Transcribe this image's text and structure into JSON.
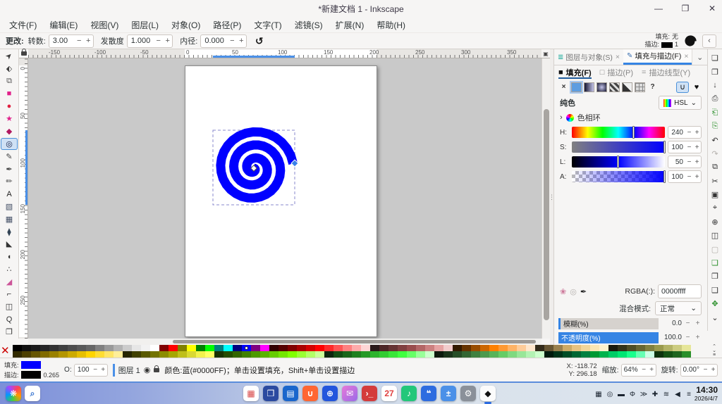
{
  "ui": {
    "minus": "−",
    "plus": "+",
    "caret": "⌄"
  },
  "window": {
    "title": "*新建文档 1 - Inkscape",
    "minimize": "—",
    "maximize": "❐",
    "close": "✕"
  },
  "menu": {
    "items": [
      "文件(F)",
      "编辑(E)",
      "视图(V)",
      "图层(L)",
      "对象(O)",
      "路径(P)",
      "文字(T)",
      "滤镜(S)",
      "扩展(N)",
      "帮助(H)"
    ]
  },
  "tool_options": {
    "prefix": "更改:",
    "fields": [
      {
        "label": "转数:",
        "value": "3.00"
      },
      {
        "label": "发散度",
        "value": "1.000"
      },
      {
        "label": "内径:",
        "value": "0.000"
      }
    ],
    "reset_icon": "↺",
    "style": {
      "fill_label": "填充:",
      "fill_value": "无",
      "stroke_label": "描边:",
      "stroke_value": "1"
    },
    "collapse": "‹"
  },
  "rulers": {
    "h": [
      "-150",
      "-100",
      "-50",
      "0",
      "50",
      "100",
      "150",
      "200",
      "250",
      "300",
      "350"
    ],
    "v": [
      "0",
      "50",
      "100",
      "150",
      "200",
      "250"
    ]
  },
  "toolbox": {
    "items": [
      {
        "name": "selector-tool",
        "glyph": "➤",
        "color": "#3d3d3d",
        "cls": "rot315"
      },
      {
        "name": "node-tool",
        "glyph": "⬖",
        "color": "#3d3d3d",
        "cls": ""
      },
      {
        "name": "shape-builder-tool",
        "glyph": "⧉",
        "color": "#555555",
        "cls": ""
      },
      {
        "name": "rectangle-tool",
        "glyph": "■",
        "color": "#e0218a",
        "cls": ""
      },
      {
        "name": "ellipse-tool",
        "glyph": "●",
        "color": "#e02040",
        "cls": ""
      },
      {
        "name": "star-tool",
        "glyph": "★",
        "color": "#e0218a",
        "cls": ""
      },
      {
        "name": "box3d-tool",
        "glyph": "◆",
        "color": "#b01860",
        "cls": ""
      },
      {
        "name": "spiral-tool",
        "glyph": "◎",
        "color": "#101840",
        "cls": "active"
      },
      {
        "name": "pencil-tool",
        "glyph": "✎",
        "color": "#444444",
        "cls": ""
      },
      {
        "name": "bezier-tool",
        "glyph": "✒",
        "color": "#444444",
        "cls": ""
      },
      {
        "name": "calligraphy-tool",
        "glyph": "✏",
        "color": "#444444",
        "cls": ""
      },
      {
        "name": "text-tool",
        "glyph": "A",
        "color": "#222222",
        "cls": ""
      },
      {
        "name": "gradient-tool",
        "glyph": "▧",
        "color": "#445066",
        "cls": ""
      },
      {
        "name": "mesh-tool",
        "glyph": "▦",
        "color": "#445066",
        "cls": ""
      },
      {
        "name": "dropper-tool",
        "glyph": "⧫",
        "color": "#334455",
        "cls": ""
      },
      {
        "name": "paint-bucket-tool",
        "glyph": "◣",
        "color": "#333333",
        "cls": ""
      },
      {
        "name": "tweak-tool",
        "glyph": "◖",
        "color": "#333333",
        "cls": ""
      },
      {
        "name": "spray-tool",
        "glyph": "∴",
        "color": "#333333",
        "cls": ""
      },
      {
        "name": "eraser-tool",
        "glyph": "◢",
        "color": "#cc5599",
        "cls": ""
      },
      {
        "name": "connector-tool",
        "glyph": "⌐",
        "color": "#333333",
        "cls": ""
      },
      {
        "name": "measure-tool",
        "glyph": "◫",
        "color": "#333333",
        "cls": ""
      },
      {
        "name": "zoom-tool",
        "glyph": "Q",
        "color": "#333333",
        "cls": ""
      },
      {
        "name": "pages-tool",
        "glyph": "❐",
        "color": "#333333",
        "cls": ""
      }
    ]
  },
  "canvas": {
    "spiral_color": "#0000ff",
    "handle_color": "#3a80e8"
  },
  "commands": {
    "items": [
      {
        "name": "new-document-button",
        "glyph": "❏",
        "cls": ""
      },
      {
        "name": "open-button",
        "glyph": "❐",
        "cls": ""
      },
      {
        "name": "save-button",
        "glyph": "↓",
        "cls": ""
      },
      {
        "name": "print-button",
        "glyph": "⎙",
        "cls": ""
      },
      {
        "name": "import-button",
        "glyph": "⎗",
        "cls": "grn"
      },
      {
        "name": "export-button",
        "glyph": "⎘",
        "cls": "grn"
      },
      {
        "name": "undo-button",
        "glyph": "↶",
        "cls": ""
      },
      {
        "name": "redo-button",
        "glyph": "↷",
        "cls": "dim"
      },
      {
        "name": "copy-button",
        "glyph": "⧉",
        "cls": ""
      },
      {
        "name": "cut-button",
        "glyph": "✂",
        "cls": ""
      },
      {
        "name": "paste-button",
        "glyph": "▣",
        "cls": ""
      },
      {
        "name": "zoom-selection-button",
        "glyph": "⌖",
        "cls": ""
      },
      {
        "name": "zoom-drawing-button",
        "glyph": "⊕",
        "cls": ""
      },
      {
        "name": "zoom-page-button",
        "glyph": "◫",
        "cls": ""
      },
      {
        "name": "page-border-button",
        "glyph": "▢",
        "cls": "dim"
      },
      {
        "name": "duplicate-button",
        "glyph": "❏",
        "cls": "grn"
      },
      {
        "name": "clone-button",
        "glyph": "❐",
        "cls": ""
      },
      {
        "name": "unlink-clone-button",
        "glyph": "❑",
        "cls": ""
      },
      {
        "name": "transform-button",
        "glyph": "✥",
        "cls": "grn"
      },
      {
        "name": "more-commands-button",
        "glyph": "⌄",
        "cls": ""
      }
    ]
  },
  "dock": {
    "tabs": [
      {
        "name": "tab-layers-objects",
        "icon": "≣",
        "label": "图层与对象(S)",
        "close": "×",
        "cls": ""
      },
      {
        "name": "tab-fill-stroke",
        "icon": "✎",
        "label": "填充与描边(F)",
        "close": "×",
        "cls": "active"
      }
    ],
    "tabs_more": "⌄",
    "subtabs": [
      {
        "name": "subtab-fill",
        "icon": "■",
        "label": "填充(F)",
        "cls": "active"
      },
      {
        "name": "subtab-stroke-paint",
        "icon": "□",
        "label": "描边(P)",
        "cls": ""
      },
      {
        "name": "subtab-stroke-style",
        "icon": "=",
        "label": "描边线型(Y)",
        "cls": ""
      }
    ],
    "fill_types": [
      {
        "name": "paint-none-button",
        "glyph": "×",
        "cls": "t"
      },
      {
        "name": "paint-flat-button",
        "glyph": "",
        "cls": "flat sel"
      },
      {
        "name": "paint-linear-gradient-button",
        "glyph": "",
        "cls": "lin"
      },
      {
        "name": "paint-radial-gradient-button",
        "glyph": "",
        "cls": "rad"
      },
      {
        "name": "paint-pattern-button",
        "glyph": "",
        "cls": "pat"
      },
      {
        "name": "paint-swatch-button",
        "glyph": "",
        "cls": "swa"
      },
      {
        "name": "paint-mesh-button",
        "glyph": "",
        "cls": "mes"
      },
      {
        "name": "paint-unknown-button",
        "glyph": "?",
        "cls": "t"
      }
    ],
    "fill_rules": [
      {
        "name": "fill-rule-evenodd-button",
        "glyph": "∪",
        "cls": "sel"
      },
      {
        "name": "fill-rule-nonzero-button",
        "glyph": "♥",
        "cls": ""
      }
    ],
    "flat_label": "纯色",
    "mode_value": "HSL",
    "wheel_expander": "›",
    "wheel_label": "色相环",
    "sliders": [
      {
        "name": "hue-slider",
        "label": "H:",
        "value": "240",
        "pos": 66.7,
        "track": "tr-h"
      },
      {
        "name": "saturation-slider",
        "label": "S:",
        "value": "100",
        "pos": 100,
        "track": "tr-s"
      },
      {
        "name": "lightness-slider",
        "label": "L:",
        "value": "50",
        "pos": 50,
        "track": "tr-l"
      },
      {
        "name": "alpha-slider",
        "label": "A:",
        "value": "100",
        "pos": 100,
        "track": "tr-a"
      }
    ],
    "picker_icons": [
      {
        "name": "swatch-store-icon",
        "glyph": "❀",
        "color": "#cc7799"
      },
      {
        "name": "color-managed-icon",
        "glyph": "◎",
        "color": "#b5b1ad"
      },
      {
        "name": "eyedropper-icon",
        "glyph": "✒",
        "color": "#222222"
      }
    ],
    "rgba_label": "RGBA(:):",
    "rgba_value": "0000ffff",
    "blend_label": "混合模式:",
    "blend_value": "正常",
    "blur_label": "模糊(%)",
    "blur_value": "0.0",
    "opacity_label": "不透明度(%)",
    "opacity_value": "100.0"
  },
  "palette": {
    "none_x": "✕",
    "row1": [
      "#000000",
      "#111111",
      "#1a1a1a",
      "#262626",
      "#333333",
      "#404040",
      "#4d4d4d",
      "#595959",
      "#666666",
      "#808080",
      "#999999",
      "#b3b3b3",
      "#cccccc",
      "#e6e6e6",
      "#f2f2f2",
      "#ffffff",
      "#800000",
      "#ff0000",
      "#808000",
      "#ffff00",
      "#008000",
      "#00ff00",
      "#008080",
      "#00ffff",
      "#000080",
      "#0000ff",
      "#800080",
      "#ff00ff",
      "#330000",
      "#550000",
      "#800000",
      "#aa0000",
      "#d40000",
      "#ff0000",
      "#ff2a2a",
      "#ff5555",
      "#ff8080",
      "#ffaaaa",
      "#ffd5d5",
      "#2b1a1a",
      "#4d2626",
      "#663333",
      "#804040",
      "#994d4d",
      "#b36666",
      "#cc8080",
      "#e6a3a3",
      "#f2cccc",
      "#331a00",
      "#663300",
      "#994d00",
      "#cc6600",
      "#ff8000",
      "#ff9933",
      "#ffb366",
      "#ffcc99",
      "#ffe6cc",
      "#332b1a",
      "#665533",
      "#99804d",
      "#ccaa66",
      "#e6c280",
      "#f2d699",
      "#f9e6b3",
      "#fff2cc",
      "#1a1a0d",
      "#33331a",
      "#4d4d26",
      "#666633",
      "#808040",
      "#99994d",
      "#b3b366",
      "#cccc80",
      "#e6e699"
    ],
    "row2": [
      "#332b00",
      "#4d4000",
      "#665500",
      "#806a00",
      "#998000",
      "#b39500",
      "#ccaa00",
      "#e6bf00",
      "#ffd500",
      "#ffdd33",
      "#ffe566",
      "#ffee99",
      "#262600",
      "#404000",
      "#595900",
      "#737300",
      "#8c8c00",
      "#a6a600",
      "#bfbf1a",
      "#d9d933",
      "#f2f24d",
      "#ffff66",
      "#1a3300",
      "#264d00",
      "#336600",
      "#408000",
      "#4d9900",
      "#59b300",
      "#66cc00",
      "#73e600",
      "#80ff00",
      "#99ff33",
      "#b3ff66",
      "#ccff99",
      "#0d260d",
      "#134d13",
      "#1a661a",
      "#208020",
      "#269926",
      "#2db32d",
      "#33cc33",
      "#3ae63a",
      "#40ff40",
      "#66ff66",
      "#99ff99",
      "#ccffcc",
      "#0d1a0d",
      "#1a331a",
      "#264d26",
      "#336633",
      "#408040",
      "#4d994d",
      "#59b359",
      "#66cc66",
      "#80d980",
      "#99e699",
      "#b3f2b3",
      "#ccffcc",
      "#001a0d",
      "#003319",
      "#004d26",
      "#006633",
      "#008040",
      "#009933",
      "#00b34d",
      "#00cc66",
      "#00e673",
      "#1aff8c",
      "#66ffb3",
      "#ccffe6",
      "#0d330d",
      "#145214",
      "#1f661f",
      "#2a8f2a"
    ],
    "controls": [
      {
        "name": "palette-scroll-up",
        "glyph": "⌃"
      },
      {
        "name": "palette-scroll-down",
        "glyph": "⌄"
      },
      {
        "name": "palette-menu",
        "glyph": "≡"
      }
    ]
  },
  "statusbar": {
    "fill_label": "填充:",
    "fill_color": "#0000ff",
    "stroke_label": "描边:",
    "stroke_color": "#000000",
    "stroke_width": "0.265",
    "opacity_label": "O:",
    "opacity_value": "100",
    "layer_label": "图层 1",
    "message": "颜色:蓝(#0000FF)；单击设置填充，Shift+单击设置描边",
    "x_label": "X:",
    "x_value": "-118.72",
    "y_label": "Y:",
    "y_value": "296.18",
    "zoom_label": "缩放:",
    "zoom_value": "64%",
    "rotation_label": "旋转:",
    "rotation_value": "0.00°"
  },
  "taskbar": {
    "left_apps": [
      {
        "name": "launcher-icon",
        "glyph": "❋",
        "bg": "conic-gradient(from 40deg,#ff4455,#ff9900,#44cc44,#0099ff,#aa44ff,#ff4455)",
        "fg": "#ffffff",
        "cls": ""
      },
      {
        "name": "search-icon",
        "glyph": "⌕",
        "bg": "#ffffff",
        "fg": "#3a76d0",
        "cls": ""
      }
    ],
    "apps": [
      {
        "name": "multitasking-icon",
        "glyph": "▦",
        "bg": "#ffffff",
        "fg": "#d84a4a",
        "cls": ""
      },
      {
        "name": "desktop-icon",
        "glyph": "❒",
        "bg": "#2b4aa0",
        "fg": "#ffffff",
        "cls": ""
      },
      {
        "name": "file-manager-icon",
        "glyph": "▤",
        "bg": "#1a66cc",
        "fg": "#ffffff",
        "cls": ""
      },
      {
        "name": "app-store-icon",
        "glyph": "∪",
        "bg": "#ff6633",
        "fg": "#ffffff",
        "cls": ""
      },
      {
        "name": "browser-icon",
        "glyph": "⊕",
        "bg": "#2255dd",
        "fg": "#ffffff",
        "cls": ""
      },
      {
        "name": "mail-icon",
        "glyph": "✉",
        "bg": "linear-gradient(135deg,#e878d8,#9a6ae8)",
        "fg": "#ffffff",
        "cls": ""
      },
      {
        "name": "terminal-icon",
        "glyph": "›_",
        "bg": "#d43c3c",
        "fg": "#ffffff",
        "cls": ""
      },
      {
        "name": "calendar-icon",
        "glyph": "27",
        "bg": "#ffffff",
        "fg": "#e04040",
        "cls": ""
      },
      {
        "name": "music-icon",
        "glyph": "♪",
        "bg": "#22c77a",
        "fg": "#ffffff",
        "cls": ""
      },
      {
        "name": "text-editor-icon",
        "glyph": "❝",
        "bg": "#2d6ce0",
        "fg": "#ffffff",
        "cls": ""
      },
      {
        "name": "calculator-icon",
        "glyph": "±",
        "bg": "#4a90e8",
        "fg": "#ffffff",
        "cls": ""
      },
      {
        "name": "control-center-icon",
        "glyph": "⚙",
        "bg": "#8a9099",
        "fg": "#ffffff",
        "cls": ""
      },
      {
        "name": "inkscape-icon",
        "glyph": "◆",
        "bg": "#fbfbfb",
        "fg": "#111111",
        "cls": "active"
      }
    ],
    "tray": [
      {
        "name": "input-method-tray-icon",
        "glyph": "▦"
      },
      {
        "name": "bluetooth-tray-icon",
        "glyph": "◎"
      },
      {
        "name": "battery-tray-icon",
        "glyph": "▬"
      },
      {
        "name": "power-tray-icon",
        "glyph": "Φ"
      },
      {
        "name": "workspace-tray-icon",
        "glyph": "≫"
      },
      {
        "name": "usb-tray-icon",
        "glyph": "✚"
      },
      {
        "name": "wifi-tray-icon",
        "glyph": "≋"
      },
      {
        "name": "volume-tray-icon",
        "glyph": "◀"
      },
      {
        "name": "storage-tray-icon",
        "glyph": "≡"
      }
    ],
    "time": "14:30",
    "date": "2026/4/7"
  }
}
